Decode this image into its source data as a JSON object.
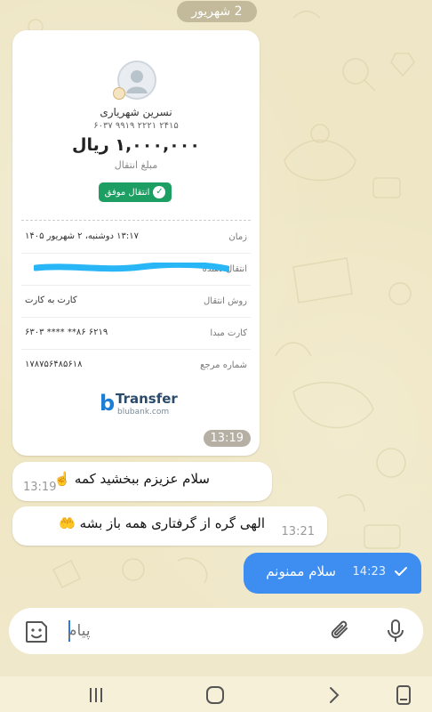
{
  "chat": {
    "date_label": "2 شهریور",
    "receipt": {
      "recipient_name": "نسرین شهریاری",
      "card_number": "۶۰۳۷ ۹۹۱۹ ۲۲۲۱ ۲۴۱۵",
      "amount": "۱,۰۰۰,۰۰۰ ریال",
      "amount_label": "مبلغ انتقال",
      "status": "انتقال موفق",
      "rows": [
        {
          "label": "زمان",
          "value": "۱۳:۱۷ دوشنبه، ۲ شهریور ۱۴۰۵"
        },
        {
          "label": "انتقال دهنده",
          "value": ""
        },
        {
          "label": "روش انتقال",
          "value": "کارت به کارت"
        },
        {
          "label": "کارت مبدا",
          "value": "۶۲۱۹ ۸۶** **** ۶۳۰۳"
        },
        {
          "label": "شماره مرجع",
          "value": "۱۷۸۷۵۶۴۸۵۶۱۸"
        }
      ],
      "brand_name": "Transfer",
      "brand_site": "blubank.com",
      "time": "13:19"
    },
    "messages": [
      {
        "direction": "in",
        "text": "سلام عزیزم ببخشید کمه ☝️",
        "time": "13:19"
      },
      {
        "direction": "in",
        "text": "الهی گره از گرفتاری همه باز بشه 🤲",
        "time": "13:21"
      },
      {
        "direction": "out",
        "text": "سلام ممنونم",
        "time": "14:23",
        "status": "sent"
      }
    ]
  },
  "composer": {
    "placeholder": "پیام",
    "sticker_icon": "sticker-icon",
    "attach_icon": "paperclip-icon",
    "mic_icon": "microphone-icon"
  },
  "navbar": {
    "icons": [
      "recents-icon",
      "home-icon",
      "back-icon",
      "screen-icon"
    ]
  },
  "colors": {
    "outgoing_bubble": "#3d8ef0",
    "success": "#1d9f64",
    "wallpaper": "#efe8c9"
  }
}
